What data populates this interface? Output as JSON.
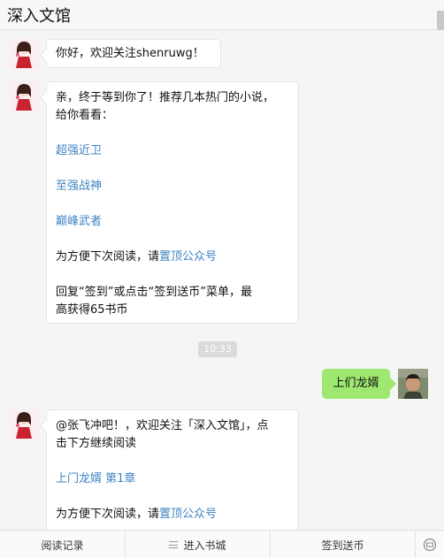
{
  "header": {
    "title": "深入文馆"
  },
  "messages": {
    "m1": {
      "text": "你好，欢迎关注shenruwg！"
    },
    "m2": {
      "line1": "亲，终于等到你了！推荐几本热门的小说，",
      "line2": "给你看看：",
      "links": [
        "超强近卫",
        "至强战神",
        "巅峰武者"
      ],
      "pin_prefix": "为方便下次阅读，请",
      "pin_link": "置顶公众号",
      "reply_line1": "回复“签到”或点击“签到送币”菜单，最",
      "reply_line2": "高获得65书币"
    },
    "timestamp": "10:33",
    "user_msg": "上们龙婿",
    "m3": {
      "line1": "@张飞冲吧！，欢迎关注「深入文馆」，点",
      "line2": "击下方继续阅读",
      "book_link": "上门龙婿 第1章",
      "pin_prefix": "为方便下次阅读，请",
      "pin_link": "置顶公众号"
    }
  },
  "menu": {
    "items": [
      "阅读记录",
      "进入书城",
      "签到送币"
    ]
  },
  "colors": {
    "link": "#3f84c3",
    "user_bubble": "#9fe870",
    "background": "#f5f5f5"
  }
}
